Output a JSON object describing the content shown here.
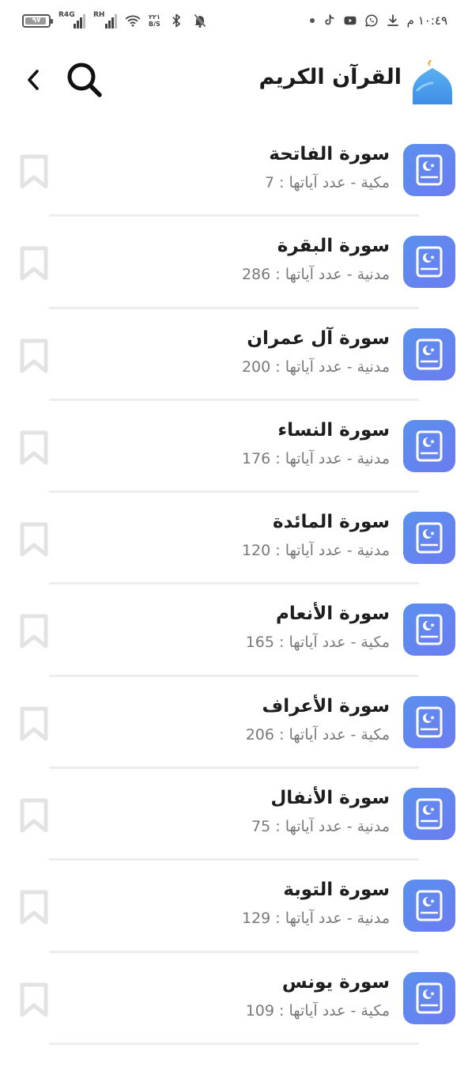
{
  "status_bar": {
    "battery": "٩٧",
    "sim1": "R4G",
    "sim2": "RH",
    "speed_value": "٢٢١",
    "speed_unit": "B/S",
    "time": "١٠:٤٩ م"
  },
  "header": {
    "title": "القرآن الكريم",
    "icons": {
      "back": "chevron-left-icon",
      "search": "search-icon",
      "logo": "mosque-icon"
    }
  },
  "colors": {
    "accent": "#5a90ee",
    "accent_end": "#6c7cf0",
    "divider": "#ededed",
    "bookmark": "#e3e3e3"
  },
  "surahs": [
    {
      "name": "سورة الفاتحة",
      "info": "مكية - عدد آياتها : 7"
    },
    {
      "name": "سورة البقرة",
      "info": "مدنية - عدد آياتها : 286"
    },
    {
      "name": "سورة آل عمران",
      "info": "مدنية - عدد آياتها : 200"
    },
    {
      "name": "سورة النساء",
      "info": "مدنية - عدد آياتها : 176"
    },
    {
      "name": "سورة المائدة",
      "info": "مدنية - عدد آياتها : 120"
    },
    {
      "name": "سورة الأنعام",
      "info": "مكية - عدد آياتها : 165"
    },
    {
      "name": "سورة الأعراف",
      "info": "مكية - عدد آياتها : 206"
    },
    {
      "name": "سورة الأنفال",
      "info": "مدنية - عدد آياتها : 75"
    },
    {
      "name": "سورة التوبة",
      "info": "مدنية - عدد آياتها : 129"
    },
    {
      "name": "سورة يونس",
      "info": "مكية - عدد آياتها : 109"
    }
  ]
}
